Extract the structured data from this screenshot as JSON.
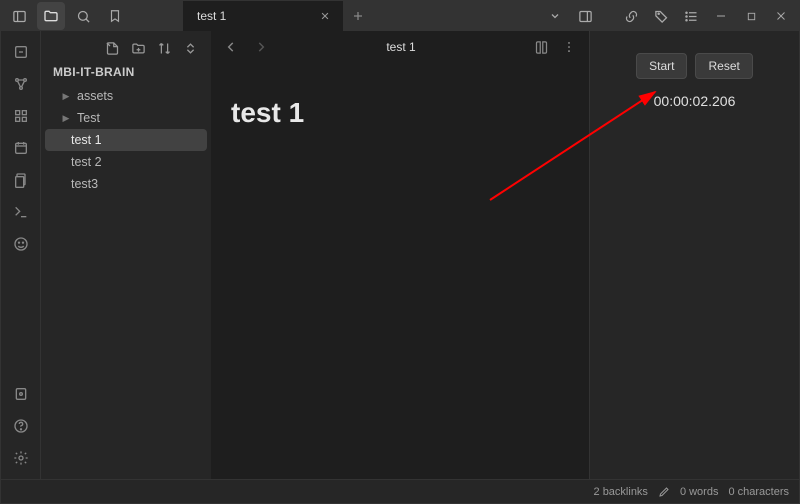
{
  "tab": {
    "title": "test 1"
  },
  "sidebar": {
    "vault": "MBI-IT-BRAIN",
    "folders": [
      "assets",
      "Test"
    ],
    "files": [
      "test 1",
      "test 2",
      "test3"
    ],
    "selectedFile": "test 1"
  },
  "editor": {
    "breadcrumb": "test 1",
    "noteTitle": "test 1"
  },
  "timer": {
    "startLabel": "Start",
    "resetLabel": "Reset",
    "display": "00:00:02.206"
  },
  "status": {
    "backlinks": "2 backlinks",
    "words": "0 words",
    "chars": "0 characters"
  }
}
